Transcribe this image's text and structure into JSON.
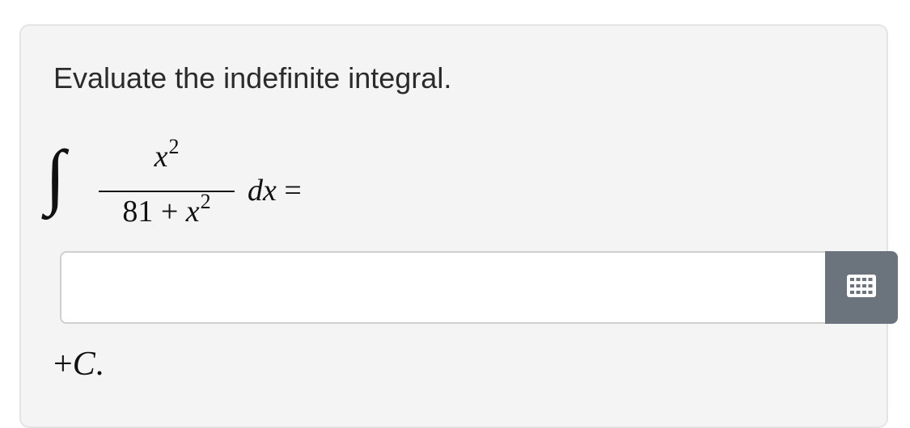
{
  "question": {
    "prompt": "Evaluate the indefinite integral.",
    "integral_symbol": "∫",
    "numerator_var": "x",
    "numerator_exp": "2",
    "denominator_const": "81 + ",
    "denominator_var": "x",
    "denominator_exp": "2",
    "differential": "dx",
    "equals": " ="
  },
  "answer": {
    "value": "",
    "placeholder": ""
  },
  "keypad": {
    "icon": "keypad-grid-icon",
    "color": "#6b747d"
  },
  "suffix": {
    "plus": "+",
    "constant": "C",
    "period": "."
  }
}
